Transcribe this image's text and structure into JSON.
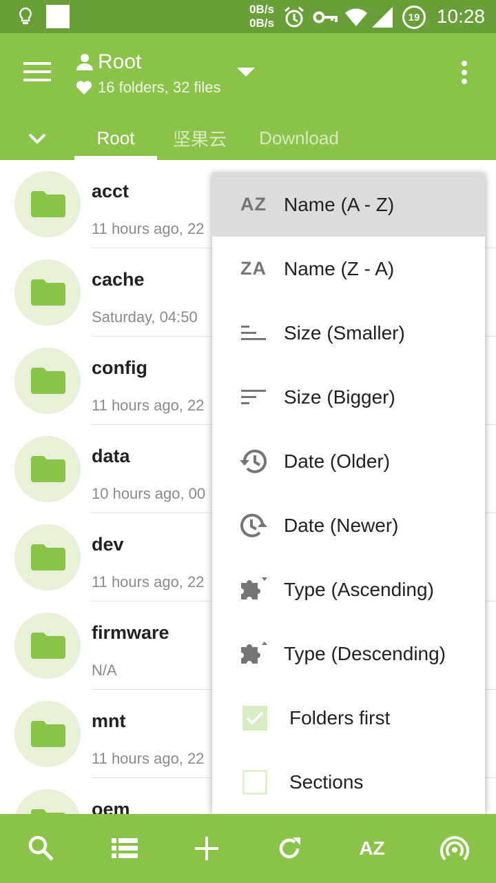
{
  "status_bar": {
    "speed_up": "0B/s",
    "speed_down": "0B/s",
    "battery_level": "19",
    "time": "10:28"
  },
  "app_bar": {
    "title": "Root",
    "subtitle": "16 folders, 32 files",
    "tabs": [
      {
        "label": "Root",
        "active": true
      },
      {
        "label": "坚果云",
        "active": false
      },
      {
        "label": "Download",
        "active": false
      }
    ]
  },
  "files": [
    {
      "name": "acct",
      "meta": "11 hours ago, 22"
    },
    {
      "name": "cache",
      "meta": "Saturday, 04:50"
    },
    {
      "name": "config",
      "meta": "11 hours ago, 22"
    },
    {
      "name": "data",
      "meta": "10 hours ago, 00"
    },
    {
      "name": "dev",
      "meta": "11 hours ago, 22"
    },
    {
      "name": "firmware",
      "meta": "N/A"
    },
    {
      "name": "mnt",
      "meta": "11 hours ago, 22"
    },
    {
      "name": "oem",
      "meta": ""
    }
  ],
  "sort_menu": {
    "items": [
      {
        "icon": "AZ",
        "label": "Name (A - Z)",
        "selected": true
      },
      {
        "icon": "ZA",
        "label": "Name (Z - A)"
      },
      {
        "icon": "size-smaller-icon",
        "label": "Size (Smaller)"
      },
      {
        "icon": "size-bigger-icon",
        "label": "Size (Bigger)"
      },
      {
        "icon": "history-icon",
        "label": "Date (Older)"
      },
      {
        "icon": "clock-forward-icon",
        "label": "Date (Newer)"
      },
      {
        "icon": "puzzle-down-icon",
        "label": "Type (Ascending)"
      },
      {
        "icon": "puzzle-up-icon",
        "label": "Type (Descending)"
      }
    ],
    "checkboxes": [
      {
        "label": "Folders first",
        "checked": true
      },
      {
        "label": "Sections",
        "checked": false
      }
    ]
  },
  "bottom_bar": {
    "sort_label": "AZ"
  },
  "colors": {
    "status_bar": "#689f38",
    "primary": "#8bc34a",
    "folder": "#8bc34a",
    "avatar_bg": "#e6f1d8",
    "menu_selected": "#dcdcdc"
  }
}
